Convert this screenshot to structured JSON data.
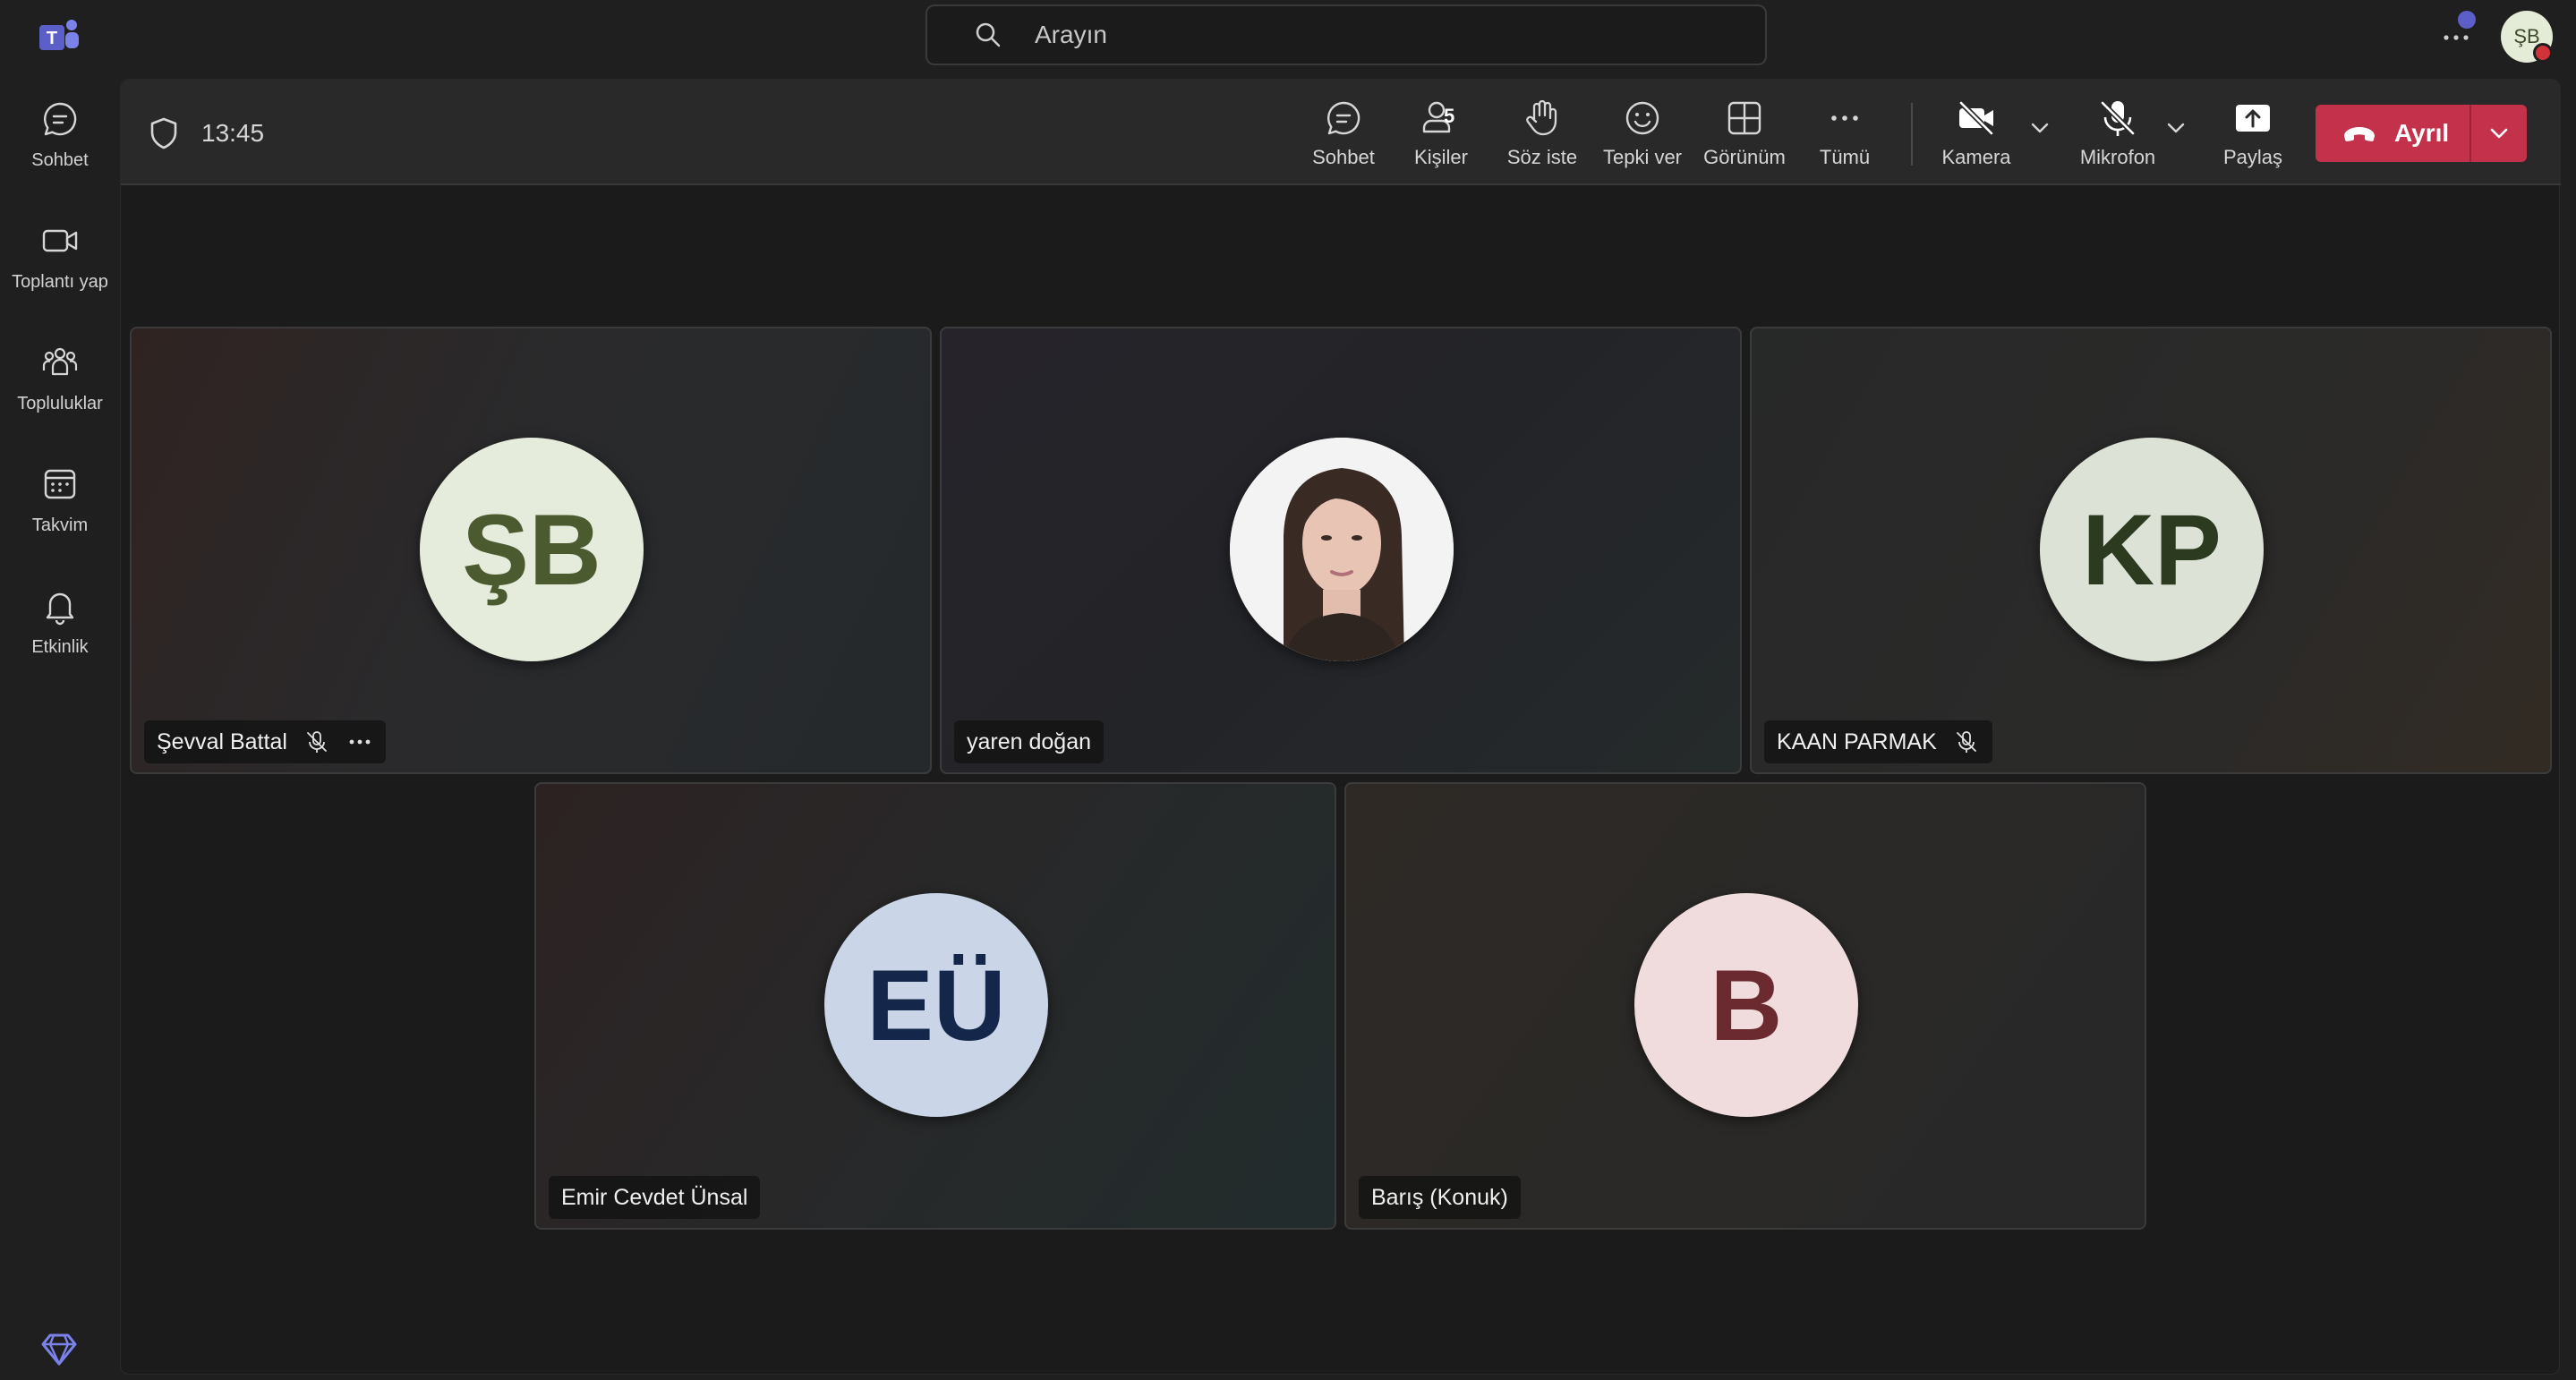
{
  "search": {
    "placeholder": "Arayın"
  },
  "me": {
    "initials": "ŞB"
  },
  "rail": [
    {
      "label": "Sohbet",
      "icon": "chat-icon"
    },
    {
      "label": "Toplantı yap",
      "icon": "video-icon"
    },
    {
      "label": "Topluluklar",
      "icon": "communities-icon"
    },
    {
      "label": "Takvim",
      "icon": "calendar-icon"
    },
    {
      "label": "Etkinlik",
      "icon": "bell-icon"
    }
  ],
  "meeting": {
    "time": "13:45",
    "toolbar": {
      "chat": "Sohbet",
      "people": "Kişiler",
      "people_count": "5",
      "raise_hand": "Söz iste",
      "react": "Tepki ver",
      "view": "Görünüm",
      "more": "Tümü",
      "camera": "Kamera",
      "mic": "Mikrofon",
      "share": "Paylaş",
      "leave": "Ayrıl"
    },
    "participants": [
      {
        "name": "Şevval Battal",
        "initials": "ŞB",
        "muted": true,
        "more": true,
        "avatar_bg": "#e6ecdc",
        "avatar_fg": "#4c5a30"
      },
      {
        "name": "yaren doğan",
        "photo": true,
        "muted": false
      },
      {
        "name": "KAAN PARMAK",
        "initials": "KP",
        "muted": true,
        "avatar_bg": "#dde2d6",
        "avatar_fg": "#2c3a20"
      },
      {
        "name": "Emir Cevdet Ünsal",
        "initials": "EÜ",
        "muted": false,
        "avatar_bg": "#cad6e8",
        "avatar_fg": "#14264a"
      },
      {
        "name": "Barış (Konuk)",
        "initials": "B",
        "muted": false,
        "avatar_bg": "#f0dcdc",
        "avatar_fg": "#6a2a30"
      }
    ]
  },
  "colors": {
    "accent": "#5b5fc7",
    "leave": "#c4314b"
  }
}
